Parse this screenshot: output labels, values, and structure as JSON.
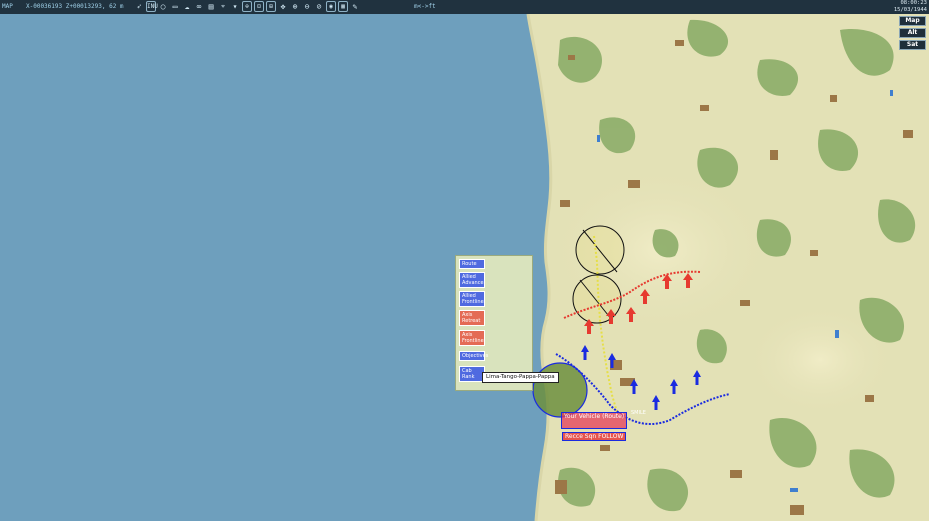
{
  "toolbar": {
    "mode": "MAP",
    "coordinates": "X-00036193 Z+00013293, 62 m",
    "units_toggle": "m<->ft",
    "icons": [
      "cursor-icon",
      "grid-toggle-icon",
      "circle-tool-icon",
      "label-tool-icon",
      "cloud-icon",
      "link-icon",
      "layers-icon",
      "signal-icon",
      "filter-icon",
      "zoom-area-icon",
      "zoom-box-icon",
      "zoom-fit-icon",
      "pan-icon",
      "zoom-in-icon",
      "zoom-out-icon",
      "zoom-reset-icon",
      "globe-icon",
      "grid-icon",
      "pencil-icon"
    ],
    "grid_toggle_label": "INU",
    "clock_time": "08:00:23",
    "clock_date": "15/03/1944"
  },
  "map_buttons": {
    "map": "Map",
    "alt": "Alt",
    "sat": "Sat"
  },
  "legend": {
    "route": "Route",
    "allied_advance": "Allied Advance",
    "allied_front": "Allied Frontline",
    "axis_retreat": "Axis Retreat",
    "axis_front": "Axis Frontline",
    "objectives": "Objectives",
    "cab_rank": "Cab Rank"
  },
  "callout": "Lima-Tango-Pappa-Pappa",
  "unit_labels": {
    "vehicle": "Your Vehicle (Route)",
    "recce": "Recce Sqn FOLLOW",
    "smile": "SMILE"
  },
  "colors": {
    "sea": "#6e9fbd",
    "land": "#e4e2b8",
    "forest": "#8cae6a",
    "town": "#9b7645",
    "allied": "#1a2be0",
    "axis": "#e63a30",
    "route": "#e6e04a"
  }
}
